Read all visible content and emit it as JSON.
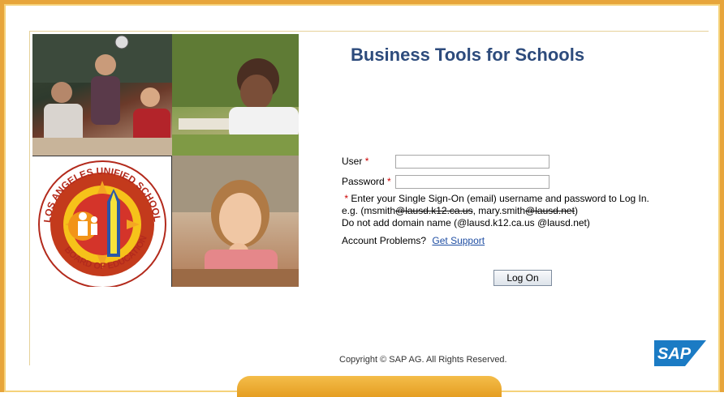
{
  "page": {
    "title": "Business Tools for Schools"
  },
  "form": {
    "user_label": "User",
    "password_label": "Password",
    "required_marker": "*",
    "user_value": "",
    "password_value": "",
    "hint_line1": "Enter your Single Sign-On (email) username and password to Log In.",
    "hint_line2_prefix": "e.g. (msmith",
    "hint_line2_strike1": "@lausd.k12.ca.us",
    "hint_line2_middle": ", mary.smith",
    "hint_line2_strike2": "@lausd.net",
    "hint_line2_suffix": ")",
    "hint_line3": "Do not add domain name (@lausd.k12.ca.us @lausd.net)",
    "account_problems": "Account Problems?",
    "support_link": "Get Support",
    "logon_button": "Log On"
  },
  "footer": {
    "copyright": "Copyright © SAP AG. All Rights Reserved.",
    "sap_logo_text": "SAP"
  },
  "seal": {
    "top_text": "LOS ANGELES UNIFIED SCHOOL DISTRICT",
    "bottom_text": "BOARD OF EDUCATION"
  },
  "colors": {
    "frame": "#e7a53b",
    "title": "#2d4b7c",
    "link": "#1f4ea3",
    "required": "#cc0000",
    "sap_blue": "#1b7bc4"
  }
}
